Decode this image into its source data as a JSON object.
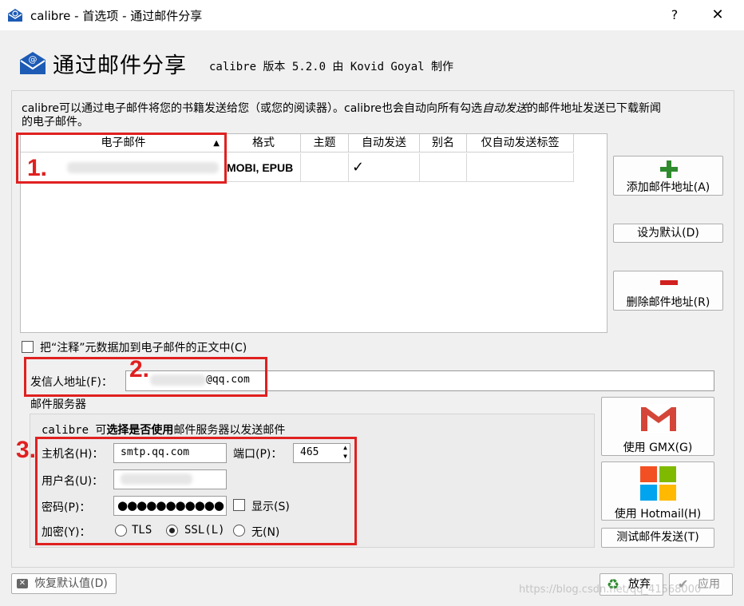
{
  "window": {
    "title": "calibre - 首选项 - 通过邮件分享",
    "help": "?",
    "close": "✕"
  },
  "header": {
    "title": "通过邮件分享",
    "version": "calibre 版本 5.2.0 由 Kovid Goyal 制作"
  },
  "description": {
    "line1_a": "calibre可以通过电子邮件将您的书籍发送给您（或您的阅读器）。calibre也会自动向所有勾选",
    "line1_italic": "自动发送",
    "line1_b": "的邮件地址发送已下载新闻",
    "line2": "的电子邮件。"
  },
  "table": {
    "columns": [
      "电子邮件",
      "格式",
      "主题",
      "自动发送",
      "别名",
      "仅自动发送标签"
    ],
    "sort_indicator": "▲",
    "rows": [
      {
        "email": "",
        "formats": "MOBI, EPUB",
        "subject": "",
        "auto_send": "✓",
        "alias": "",
        "tags": ""
      }
    ]
  },
  "buttons": {
    "add": "添加邮件地址(A)",
    "default": "设为默认(D)",
    "remove": "删除邮件地址(R)",
    "gmx": "使用 GMX(G)",
    "hotmail": "使用 Hotmail(H)",
    "test": "测试邮件发送(T)",
    "restore": "恢复默认值(D)",
    "discard": "放弃",
    "apply": "应用"
  },
  "options": {
    "add_comments": "把“注释”元数据加到电子邮件的正文中(C)"
  },
  "sender": {
    "label": "发信人地址(F)：",
    "value": "@qq.com"
  },
  "server": {
    "group_label": "邮件服务器",
    "intro_a": "calibre 可",
    "intro_bold": "选择是否使用",
    "intro_b": "邮件服务器以发送邮件",
    "host_label": "主机名(H)：",
    "host_value": "smtp.qq.com",
    "port_label": "端口(P)：",
    "port_value": "465",
    "user_label": "用户名(U)：",
    "user_value": "",
    "password_label": "密码(P)：",
    "password_value": "●●●●●●●●●●●",
    "show_label": "显示(S)",
    "encryption_label": "加密(Y)：",
    "enc_tls": "TLS",
    "enc_ssl": "SSL(L)",
    "enc_none": "无(N)",
    "selected": "SSL"
  },
  "annotations": [
    "1.",
    "2.",
    "3."
  ],
  "watermark": "https://blog.csdn.net/qq_41568000",
  "colors": {
    "annotation_red": "#e02020",
    "add_green": "#2e8b2e",
    "remove_red": "#d02020"
  }
}
